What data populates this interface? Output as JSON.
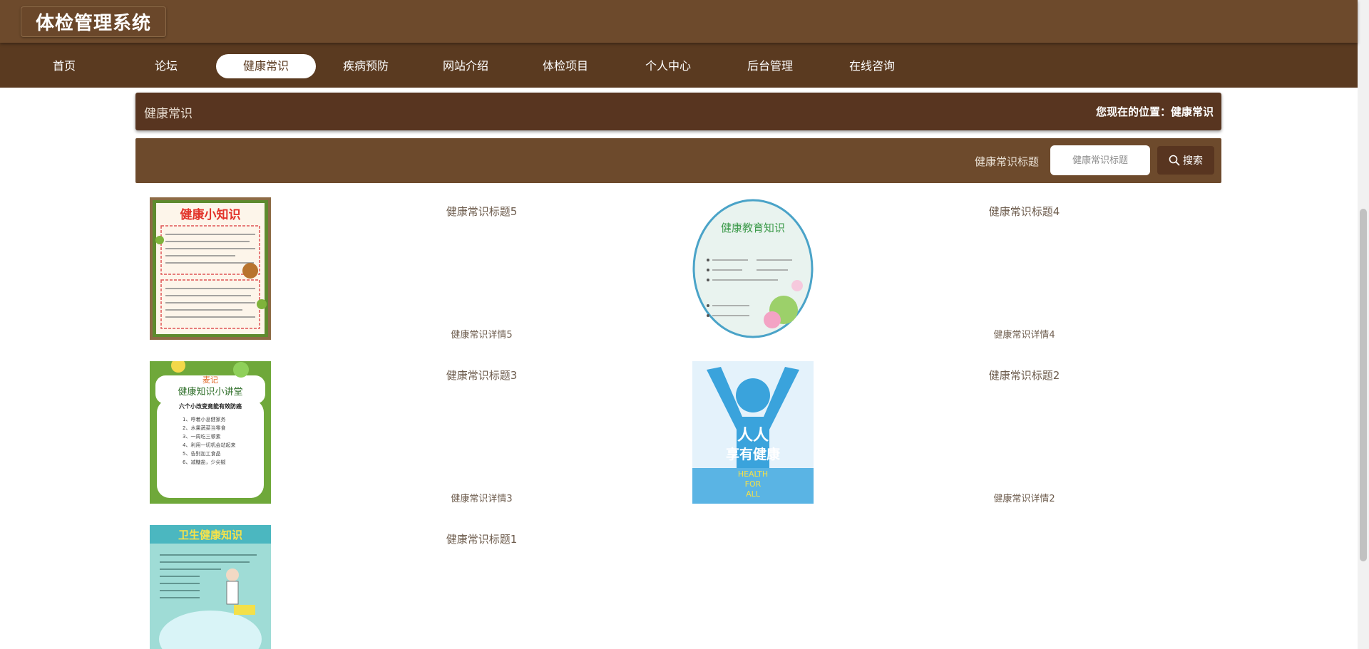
{
  "header": {
    "app_title": "体检管理系统"
  },
  "nav": {
    "items": [
      {
        "label": "首页"
      },
      {
        "label": "论坛"
      },
      {
        "label": "健康常识"
      },
      {
        "label": "疾病预防"
      },
      {
        "label": "网站介绍"
      },
      {
        "label": "体检项目"
      },
      {
        "label": "个人中心"
      },
      {
        "label": "后台管理"
      },
      {
        "label": "在线咨询"
      }
    ],
    "active_label": "健康常识"
  },
  "breadcrumb": {
    "title": "健康常识",
    "location_prefix": "您现在的位置：",
    "location_current": "健康常识"
  },
  "search": {
    "label": "健康常识标题",
    "placeholder": "健康常识标题",
    "button_label": "搜索",
    "icon": "search-icon"
  },
  "list": {
    "items": [
      {
        "title": "健康常识标题5",
        "detail": "健康常识详情5",
        "image_text": [
          "健康小知识"
        ]
      },
      {
        "title": "健康常识标题4",
        "detail": "健康常识详情4",
        "image_text": [
          "健康教育知识"
        ]
      },
      {
        "title": "健康常识标题3",
        "detail": "健康常识详情3",
        "image_text": [
          "麦记",
          "健康知识小讲堂",
          "六个小改变竟能有效防癌",
          "1、呼着小息健家务",
          "2、水果蔬菜当零食",
          "3、一周吃三顿素",
          "4、利用一切机会站起来",
          "5、告别加工食品",
          "6、减糖盐，少尖椒"
        ]
      },
      {
        "title": "健康常识标题2",
        "detail": "健康常识详情2",
        "image_text": [
          "人人",
          "享有健康",
          "HEALTH",
          "FOR",
          "ALL"
        ]
      },
      {
        "title": "健康常识标题1",
        "detail": "",
        "image_text": [
          "卫生健康知识"
        ]
      }
    ]
  },
  "colors": {
    "header_bg": "#6d4a2c",
    "nav_bg": "#5a3a20",
    "crumb_bg": "#583520",
    "accent_text": "#6e5d4e"
  }
}
